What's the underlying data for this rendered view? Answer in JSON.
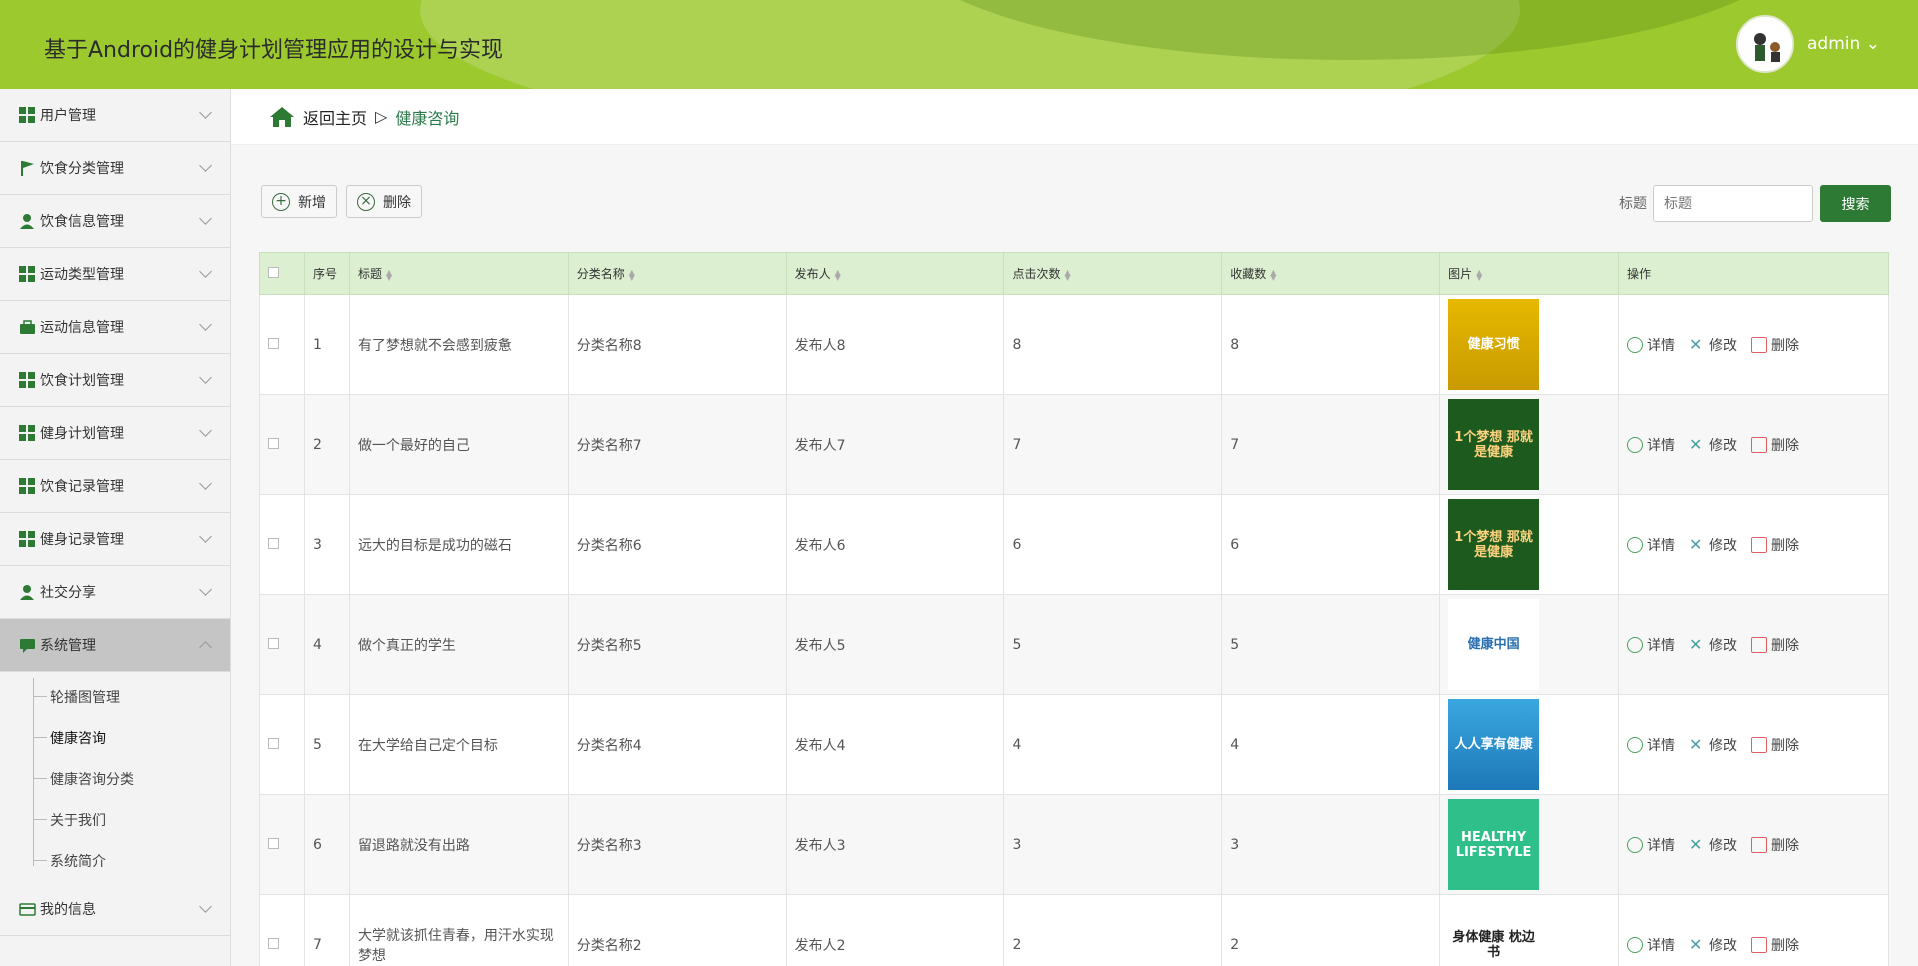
{
  "app": {
    "title": "基于Android的健身计划管理应用的设计与实现",
    "user": "admin"
  },
  "sidebar": {
    "items": [
      {
        "label": "用户管理",
        "icon": "grid-icon"
      },
      {
        "label": "饮食分类管理",
        "icon": "flag-icon"
      },
      {
        "label": "饮食信息管理",
        "icon": "user-icon"
      },
      {
        "label": "运动类型管理",
        "icon": "grid-icon"
      },
      {
        "label": "运动信息管理",
        "icon": "briefcase-icon"
      },
      {
        "label": "饮食计划管理",
        "icon": "grid-icon"
      },
      {
        "label": "健身计划管理",
        "icon": "grid-icon"
      },
      {
        "label": "饮食记录管理",
        "icon": "grid-icon"
      },
      {
        "label": "健身记录管理",
        "icon": "grid-icon"
      },
      {
        "label": "社交分享",
        "icon": "user-icon"
      },
      {
        "label": "系统管理",
        "icon": "chat-icon"
      }
    ],
    "sub": [
      "轮播图管理",
      "健康咨询",
      "健康咨询分类",
      "关于我们",
      "系统简介"
    ],
    "last": {
      "label": "我的信息",
      "icon": "card-icon"
    }
  },
  "breadcrumb": {
    "home": "返回主页",
    "sep": "▷",
    "current": "健康咨询"
  },
  "toolbar": {
    "add": "新增",
    "delete": "删除",
    "search_label": "标题",
    "search_placeholder": "标题",
    "search_btn": "搜索"
  },
  "table": {
    "headers": [
      "序号",
      "标题",
      "分类名称",
      "发布人",
      "点击次数",
      "收藏数",
      "图片",
      "操作"
    ],
    "ops": [
      "详情",
      "修改",
      "删除"
    ],
    "rows": [
      {
        "no": "1",
        "title": "有了梦想就不会感到疲惫",
        "cat": "分类名称8",
        "pub": "发布人8",
        "clicks": "8",
        "fav": "8",
        "img": "健康习惯"
      },
      {
        "no": "2",
        "title": "做一个最好的自己",
        "cat": "分类名称7",
        "pub": "发布人7",
        "clicks": "7",
        "fav": "7",
        "img": "1个梦想 那就是健康"
      },
      {
        "no": "3",
        "title": "远大的目标是成功的磁石",
        "cat": "分类名称6",
        "pub": "发布人6",
        "clicks": "6",
        "fav": "6",
        "img": "1个梦想 那就是健康"
      },
      {
        "no": "4",
        "title": "做个真正的学生",
        "cat": "分类名称5",
        "pub": "发布人5",
        "clicks": "5",
        "fav": "5",
        "img": "健康中国"
      },
      {
        "no": "5",
        "title": "在大学给自己定个目标",
        "cat": "分类名称4",
        "pub": "发布人4",
        "clicks": "4",
        "fav": "4",
        "img": "人人享有健康"
      },
      {
        "no": "6",
        "title": "留退路就没有出路",
        "cat": "分类名称3",
        "pub": "发布人3",
        "clicks": "3",
        "fav": "3",
        "img": "HEALTHY LIFESTYLE"
      },
      {
        "no": "7",
        "title": "大学就该抓住青春，用汗水实现梦想",
        "cat": "分类名称2",
        "pub": "发布人2",
        "clicks": "2",
        "fav": "2",
        "img": "身体健康 枕边书"
      }
    ]
  }
}
